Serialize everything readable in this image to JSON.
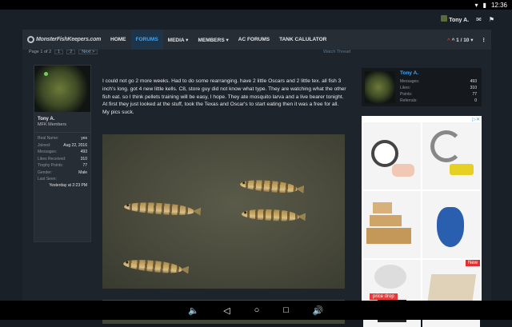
{
  "status": {
    "time": "12:36"
  },
  "userbar": {
    "username": "Tony A."
  },
  "nav": {
    "logo": "MonsterFishKeepers.com",
    "items": [
      "HOME",
      "FORUMS",
      "MEDIA ▾",
      "MEMBERS ▾",
      "AC FORUMS",
      "TANK CALULATOR"
    ],
    "pager": "^ 1 / 10 ▾"
  },
  "thread": {
    "page_label": "Page 1 of 2",
    "next_label": "Next >",
    "watch": "Watch Thread"
  },
  "author": {
    "name": "Tony A.",
    "role": "MFK Members",
    "fields": [
      {
        "k": "Real Name:",
        "v": "yes"
      },
      {
        "k": "Joined:",
        "v": "Aug 22, 2016"
      },
      {
        "k": "Messages:",
        "v": "493"
      },
      {
        "k": "Likes Received:",
        "v": "310"
      },
      {
        "k": "Trophy Points:",
        "v": "77"
      },
      {
        "k": "Gender:",
        "v": "Male"
      },
      {
        "k": "Last Seen:",
        "v": ""
      }
    ],
    "last_seen": "Yesterday at 2:23 PM"
  },
  "post": {
    "text": "I could not go 2 more weeks. Had to do some rearranging. have 2 little Oscars and 2 little tex. all fish 3 inch's long. got 4 new little kells. C8, store guy did not know what type. They are watching what the other fish eat. so I think pellets training will be easy, I hope. They ate mosquito larva and a live bearer tonight. At first they just looked at the stuff, took the Texas and Oscar's to start eating then it was a free for all. My pics suck."
  },
  "sidebar_user": {
    "name": "Tony A.",
    "stats": [
      {
        "k": "Messages:",
        "v": "493"
      },
      {
        "k": "Likes:",
        "v": "310"
      },
      {
        "k": "Points:",
        "v": "77"
      },
      {
        "k": "Referrals:",
        "v": "0"
      }
    ]
  },
  "ad": {
    "badge_new": "New",
    "price_drop": "price drop"
  }
}
